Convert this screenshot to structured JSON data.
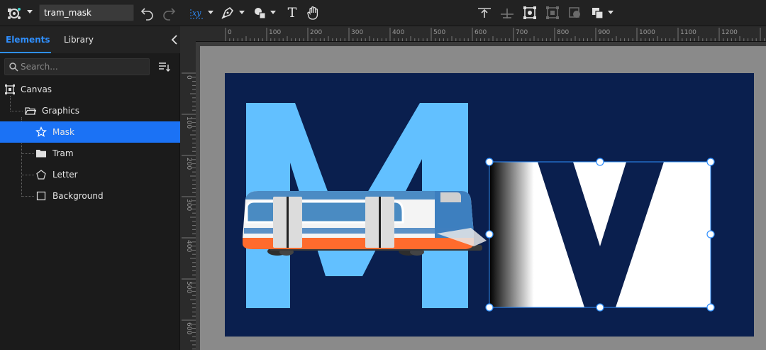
{
  "topbar": {
    "filename": "tram_mask",
    "text_tool_glyph": "T",
    "icons": [
      "app-logo-icon",
      "undo-icon",
      "redo-icon",
      "coordinate-xy-icon",
      "pen-tool-icon",
      "shapes-icon",
      "text-tool-icon",
      "hand-tool-icon",
      "align-top-icon",
      "align-middle-icon",
      "frame-icon",
      "group-icon",
      "mask-icon",
      "arrange-icon"
    ]
  },
  "panel": {
    "tabs": [
      "Elements",
      "Library"
    ],
    "search_placeholder": "Search..."
  },
  "tree": [
    {
      "label": "Canvas",
      "icon": "canvas-icon"
    },
    {
      "label": "Graphics",
      "icon": "folder-open-icon"
    },
    {
      "label": "Mask",
      "icon": "star-icon",
      "selected": true
    },
    {
      "label": "Tram",
      "icon": "folder-icon"
    },
    {
      "label": "Letter",
      "icon": "pentagon-icon"
    },
    {
      "label": "Background",
      "icon": "rectangle-icon"
    }
  ],
  "ruler": {
    "h_labels": [
      "0",
      "100",
      "200",
      "300",
      "400",
      "500",
      "600",
      "700",
      "800",
      "900",
      "1000",
      "1100",
      "1200"
    ],
    "v_labels": [
      "0",
      "100",
      "200",
      "300",
      "400",
      "500",
      "600"
    ]
  },
  "canvas": {
    "background_color": "#0a1f4e",
    "letter_m_color": "#62c0ff",
    "letter_m_text": "M",
    "letter_v_text": "V"
  }
}
